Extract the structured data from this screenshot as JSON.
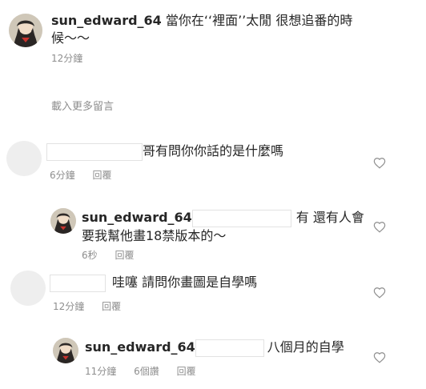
{
  "main_comment": {
    "username": "sun_edward_64",
    "text_line1": "當你在‘‘裡面’’太閒 很想追番的時",
    "text_line2": "候～～",
    "time": "12分鐘"
  },
  "load_more": "載入更多留言",
  "comments": [
    {
      "text": "哥有問你你話的是什麼嗎",
      "time": "6分鐘",
      "reply_label": "回覆",
      "reply": {
        "username": "sun_edward_64",
        "text_line1": "有 還有人會",
        "text_line2": "要我幫他畫18禁版本的～",
        "time": "6秒",
        "reply_label": "回覆"
      }
    },
    {
      "text": "哇噻 請問你畫圖是自學嗎",
      "time": "12分鐘",
      "reply_label": "回覆",
      "reply": {
        "username": "sun_edward_64",
        "text_line1": "八個月的自學",
        "time": "11分鐘",
        "likes": "6個讚",
        "reply_label": "回覆"
      }
    }
  ],
  "icons": {
    "like": "heart-outline-icon",
    "avatar": "anime-avatar-icon"
  }
}
